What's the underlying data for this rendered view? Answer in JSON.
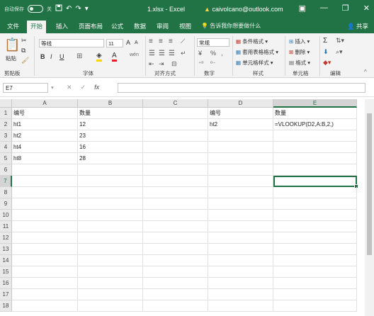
{
  "titlebar": {
    "autosave": "自动保存",
    "autosave_state": "关",
    "save_icon": "save-icon",
    "undo_icon": "undo-icon",
    "redo_icon": "redo-icon",
    "document": "1.xlsx - Excel",
    "account": "caivolcano@outlook.com",
    "min": "—",
    "restore": "❐",
    "close": "✕"
  },
  "tabs": [
    {
      "label": "文件"
    },
    {
      "label": "开始",
      "active": true
    },
    {
      "label": "插入"
    },
    {
      "label": "页面布局"
    },
    {
      "label": "公式"
    },
    {
      "label": "数据"
    },
    {
      "label": "审阅"
    },
    {
      "label": "视图"
    }
  ],
  "tellme": "告诉我你想要做什么",
  "share": "共享",
  "ribbon": {
    "clipboard": {
      "paste": "粘贴",
      "label": "剪贴板"
    },
    "font": {
      "name": "等线",
      "size": "11",
      "grow": "A",
      "shrink": "A",
      "bold": "B",
      "italic": "I",
      "underline": "U",
      "font_color_letter": "A",
      "phonetic": "wén",
      "label": "字体"
    },
    "align": {
      "label": "对齐方式"
    },
    "number": {
      "format": "常规",
      "currency": "¥",
      "percent": "%",
      "comma": ",",
      "label": "数字"
    },
    "styles": {
      "conditional": "条件格式",
      "table": "套用表格格式",
      "cell": "单元格样式",
      "label": "样式"
    },
    "cells": {
      "insert": "插入",
      "delete": "删除",
      "format": "格式",
      "label": "单元格"
    },
    "editing": {
      "sum": "Σ",
      "label": "编辑"
    }
  },
  "formula_bar": {
    "namebox": "E7",
    "cancel": "✕",
    "enter": "✓",
    "fx": "fx",
    "content": ""
  },
  "sheet": {
    "columns": [
      "A",
      "B",
      "C",
      "D",
      "E"
    ],
    "selected_column": "E",
    "selected_row": 7,
    "active_cell": "E7",
    "rows": [
      {
        "n": "1",
        "cells": [
          "编号",
          "数量",
          "",
          "编号",
          "数量"
        ]
      },
      {
        "n": "2",
        "cells": [
          "ht1",
          "12",
          "",
          "ht2",
          "=VLOOKUP(D2,A:B,2,)"
        ]
      },
      {
        "n": "3",
        "cells": [
          "ht2",
          "23",
          "",
          "",
          ""
        ]
      },
      {
        "n": "4",
        "cells": [
          "ht4",
          "16",
          "",
          "",
          ""
        ]
      },
      {
        "n": "5",
        "cells": [
          "ht8",
          "28",
          "",
          "",
          ""
        ]
      },
      {
        "n": "6",
        "cells": [
          "",
          "",
          "",
          "",
          ""
        ]
      },
      {
        "n": "7",
        "cells": [
          "",
          "",
          "",
          "",
          ""
        ]
      },
      {
        "n": "8",
        "cells": [
          "",
          "",
          "",
          "",
          ""
        ]
      },
      {
        "n": "9",
        "cells": [
          "",
          "",
          "",
          "",
          ""
        ]
      },
      {
        "n": "10",
        "cells": [
          "",
          "",
          "",
          "",
          ""
        ]
      },
      {
        "n": "11",
        "cells": [
          "",
          "",
          "",
          "",
          ""
        ]
      },
      {
        "n": "12",
        "cells": [
          "",
          "",
          "",
          "",
          ""
        ]
      },
      {
        "n": "13",
        "cells": [
          "",
          "",
          "",
          "",
          ""
        ]
      },
      {
        "n": "14",
        "cells": [
          "",
          "",
          "",
          "",
          ""
        ]
      },
      {
        "n": "15",
        "cells": [
          "",
          "",
          "",
          "",
          ""
        ]
      },
      {
        "n": "16",
        "cells": [
          "",
          "",
          "",
          "",
          ""
        ]
      },
      {
        "n": "17",
        "cells": [
          "",
          "",
          "",
          "",
          ""
        ]
      },
      {
        "n": "18",
        "cells": [
          "",
          "",
          "",
          "",
          ""
        ]
      }
    ]
  },
  "colors": {
    "accent": "#217346",
    "ribbon_bg": "#f3f3f3",
    "header_bg": "#e9e9e9"
  }
}
